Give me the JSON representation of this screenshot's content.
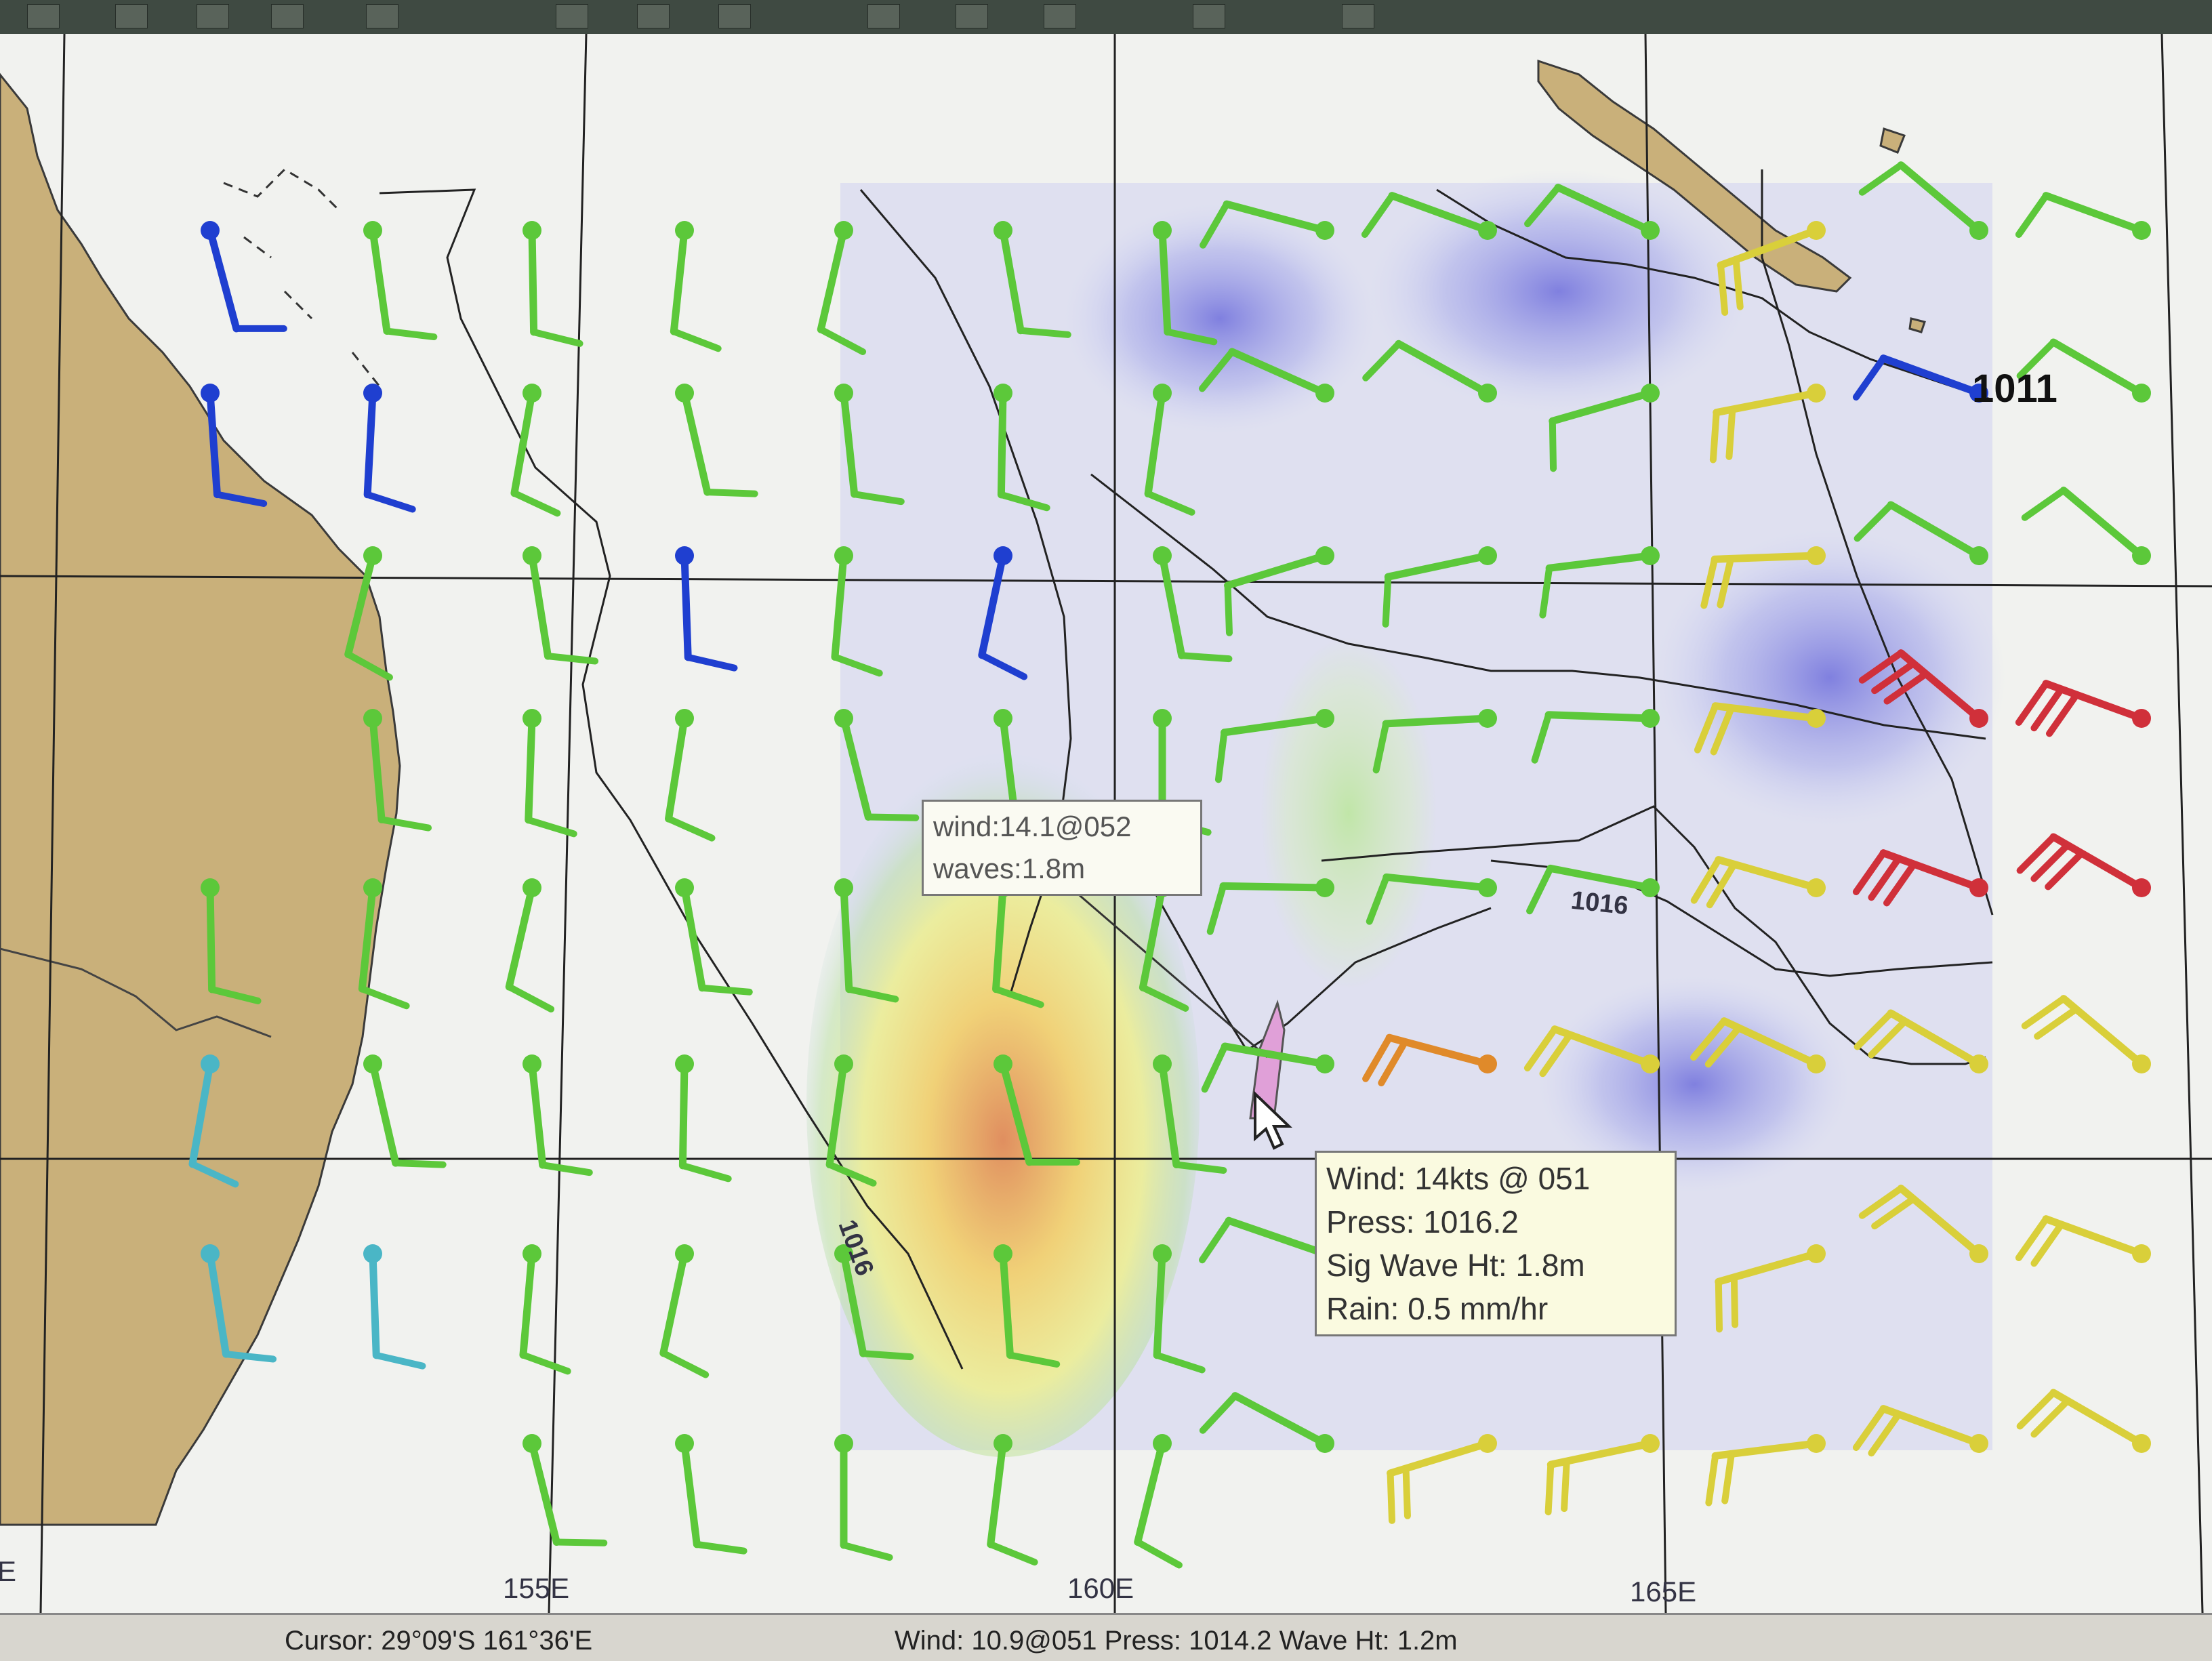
{
  "axis": {
    "longitude_labels": [
      "155E",
      "160E",
      "165E"
    ],
    "left_edge_label": "E"
  },
  "isobars": [
    {
      "label": "1011"
    },
    {
      "label": "1016"
    },
    {
      "label": "1016"
    }
  ],
  "tooltip_small": {
    "line1": "wind:14.1@052",
    "line2": "waves:1.8m"
  },
  "tooltip_main": {
    "wind": "Wind: 14kts @ 051",
    "press": "Press: 1016.2",
    "wave": "Sig Wave Ht:  1.8m",
    "rain": "Rain: 0.5 mm/hr"
  },
  "status_bar": {
    "cursor": "Cursor: 29°09'S  161°36'E",
    "wind": "Wind: 10.9@051  Press: 1014.2  Wave Ht: 1.2m"
  },
  "colors": {
    "land": "#c9b07a",
    "sea": "#f1f2ef",
    "grid": "#222222",
    "wind_light": "#1f3fd0",
    "wind_moderate": "#5cc83a",
    "wind_fresh": "#d9cf3a",
    "wind_strong": "#e08a2a",
    "wind_gale": "#d0303a",
    "wave_low": "#7b7be0",
    "wave_high": "#e58a55"
  },
  "icons": {
    "cursor": "mouse-pointer-icon",
    "boat": "boat-position-icon"
  }
}
